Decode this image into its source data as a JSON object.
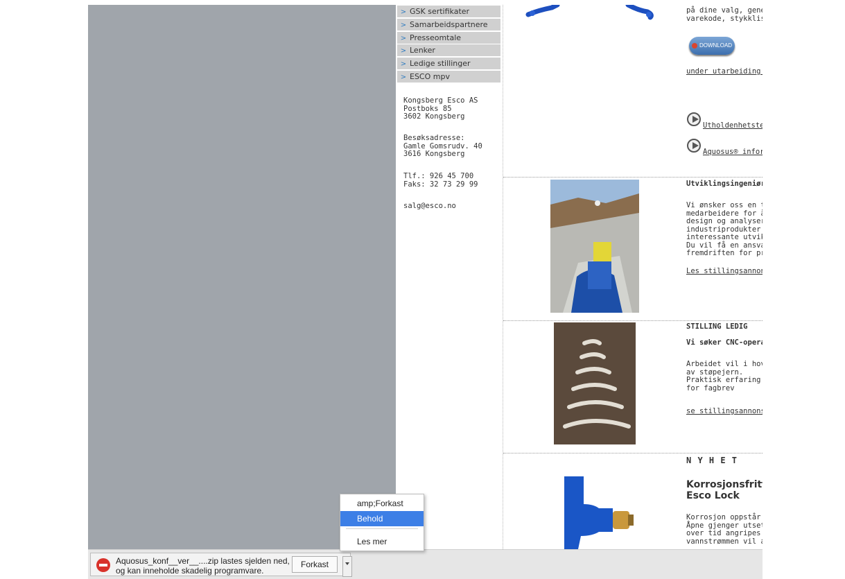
{
  "sidebar": {
    "nav": [
      "GSK sertifikater",
      "Samarbeidspartnere",
      "Presseomtale",
      "Lenker",
      "Ledige stillinger",
      "ESCO mpv"
    ],
    "address": "Kongsberg Esco AS\nPostboks 85\n3602 Kongsberg",
    "visit": "Besøksadresse:\nGamle Gomsrudv. 40\n3616 Kongsberg",
    "phone": "Tlf.: 926 45 700\nFaks: 32 73 29 99",
    "email": "salg@esco.no"
  },
  "content": {
    "top_text": "på dine valg, genere\nvarekode, stykkliste",
    "download_label": "DOWNLOAD",
    "under_link": "under utarbeiding og",
    "video_link_1": "Utholdenhetster",
    "video_link_2": "Aquosus® infor",
    "job1_title": "Utviklingsingeniører",
    "job1_body": "Vi ønsker oss en til t\nmedarbeidere for å\ndesign og analyser a\nindustriprodukter. Ut\ninteressante utviklin\nDu vil få en ansvarsf\nfremdriften for prosj",
    "job1_link": "Les stillingsannonse",
    "job2_title": "STILLING LEDIG",
    "job2_subtitle": "Vi søker CNC-operat",
    "job2_body": "Arbeidet vil i hoveds\nav støpejern.\nPraktisk erfaring fra\nfor fagbrev",
    "job2_link": "se stillingsannonsen",
    "news_label": "N Y H E T",
    "news_title": "Korrosjonsfritt\nEsco Lock",
    "news_body": "Korrosjon oppstår le\nÅpne gjenger utsette\nover tid angripes av\nvannstrømmen vil a"
  },
  "download_bar": {
    "warning": "Aquosus_konf__ver__....zip lastes sjelden ned,\nog kan inneholde skadelig programvare.",
    "discard_button": "Forkast"
  },
  "context_menu": {
    "items": [
      "amp;Forkast",
      "Behold",
      "Les mer"
    ],
    "highlight_color": "#3d7fe6"
  }
}
